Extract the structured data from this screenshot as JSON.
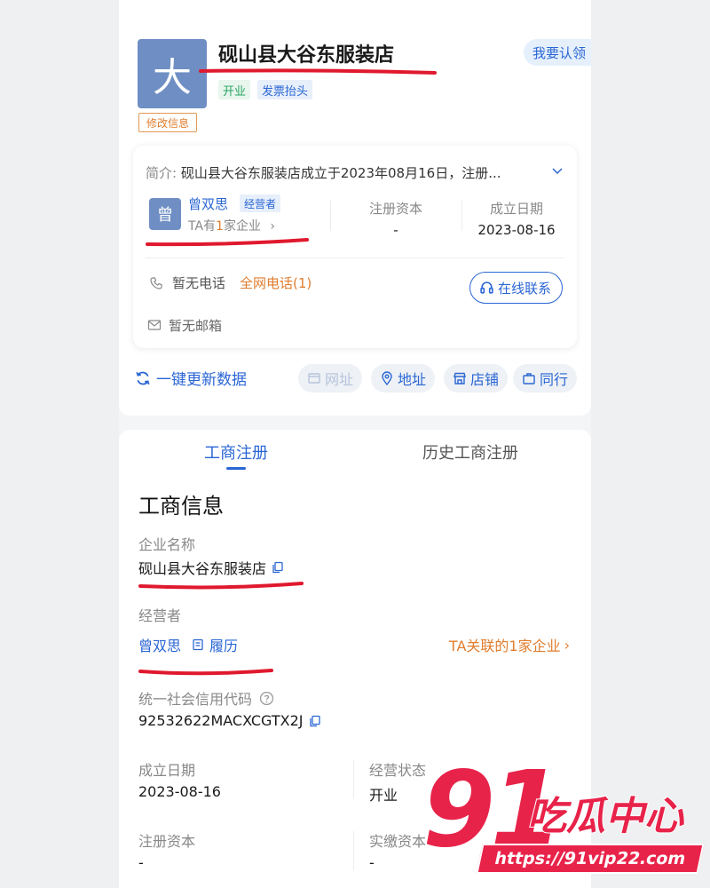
{
  "header": {
    "logo_char": "大",
    "company_name": "砚山县大谷东服装店",
    "claim_label": "我要认领",
    "tags": [
      "开业",
      "发票抬头"
    ],
    "edit_label": "修改信息"
  },
  "summary": {
    "intro_label": "简介:",
    "intro_text": "砚山县大谷东服装店成立于2023年08月16日，注册...",
    "operator": {
      "avatar_char": "曾",
      "name": "曾双思",
      "role": "经营者",
      "companies_prefix": "TA有",
      "companies_num": "1",
      "companies_suffix": "家企业"
    },
    "registered_capital": {
      "label": "注册资本",
      "value": "-"
    },
    "founded_date": {
      "label": "成立日期",
      "value": "2023-08-16"
    },
    "phone_text": "暂无电话",
    "phone_link": "全网电话(1)",
    "online_contact": "在线联系",
    "email_text": "暂无邮箱"
  },
  "actions": {
    "update": "一键更新数据",
    "website": "网址",
    "address": "地址",
    "store": "店铺",
    "peers": "同行"
  },
  "tabs": [
    "工商注册",
    "历史工商注册"
  ],
  "business_info": {
    "title": "工商信息",
    "company_name_label": "企业名称",
    "company_name_value": "砚山县大谷东服装店",
    "operator_label": "经营者",
    "operator_name": "曾双思",
    "resume_label": "履历",
    "related_companies": "TA关联的1家企业",
    "credit_code_label": "统一社会信用代码",
    "credit_code_value": "92532622MACXCGTX2J",
    "founded_label": "成立日期",
    "founded_value": "2023-08-16",
    "status_label": "经营状态",
    "status_value": "开业",
    "reg_capital_label": "注册资本",
    "reg_capital_value": "-",
    "paid_capital_label": "实缴资本",
    "paid_capital_value": "-"
  },
  "watermark": {
    "number": "91",
    "text": "吃瓜中心",
    "url": "https://91vip22.com"
  },
  "colors": {
    "primary_blue": "#2a66d4",
    "accent_orange": "#e07d2e",
    "annotation_red": "#e0192e",
    "watermark_red": "#e8234a"
  }
}
